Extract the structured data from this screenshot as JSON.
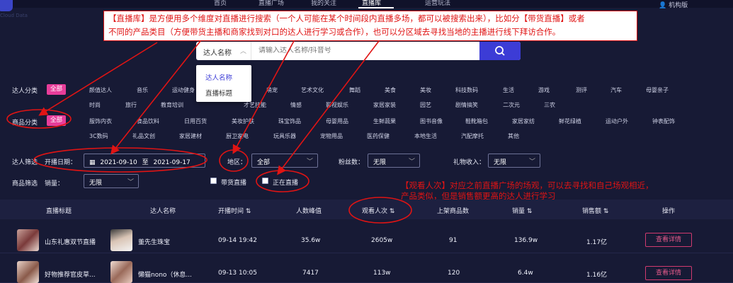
{
  "header": {
    "nav": [
      "首页",
      "直播广场",
      "我的关注",
      "直播库",
      "运营玩法"
    ],
    "active_nav": "直播库",
    "version": "机构版",
    "logo_sub": "Cloud Data"
  },
  "annotations": {
    "top_line1": "【直播库】是方便用多个维度对直播进行搜索（一个人可能在某个时间段内直播多场，都可以被搜索出来），比如分【带货直播】或者",
    "top_line2": "不同的产品类目（方便带货主播和商家找到对口的达人进行学习或合作），也可以分区域去寻找当地的主播进行线下拜访合作。",
    "mid_line1": "【观看人次】对应之前直播广场的场观，可以去寻找和自己场观相近，",
    "mid_line2": "产品类似，但是销售额更高的达人进行学习",
    "colors": {
      "red": "#e01414"
    }
  },
  "search": {
    "type_value": "达人名称",
    "placeholder": "请输入达人名称/抖音号",
    "dropdown_options": [
      "达人名称",
      "直播标题"
    ],
    "button_icon": "search-icon"
  },
  "filters": {
    "talent_category": {
      "label": "达人分类",
      "selected": "全部",
      "row1": [
        "颜值达人",
        "音乐",
        "运动健身",
        "",
        "萌宠",
        "艺术文化",
        "舞蹈",
        "美食",
        "美妆",
        "科技数码",
        "生活",
        "游戏",
        "测评",
        "汽车",
        "母婴亲子"
      ],
      "row2": [
        "时尚",
        "旅行",
        "教育培训",
        "",
        "才艺技能",
        "情感",
        "影视娱乐",
        "家居家装",
        "园艺",
        "剧情搞笑",
        "二次元",
        "三农"
      ]
    },
    "product_category": {
      "label": "商品分类",
      "selected": "全部",
      "row1": [
        "服饰内衣",
        "食品饮料",
        "日用百货",
        "美妆护肤",
        "珠宝饰品",
        "母婴用品",
        "生鲜蔬果",
        "图书音像",
        "鞋靴箱包",
        "家居家纺",
        "鲜花绿植",
        "运动户外",
        "钟表配饰"
      ],
      "row2": [
        "3C数码",
        "礼品文创",
        "家居建材",
        "厨卫家电",
        "玩具乐器",
        "宠物用品",
        "医药保健",
        "本地生活",
        "汽配摩托",
        "其他"
      ]
    },
    "talent_filter": {
      "label": "达人筛选",
      "date_label": "开播日期：",
      "date_start": "2021-09-10",
      "date_end": "2021-09-17",
      "date_sep": "至",
      "region_label": "地区：",
      "region_value": "全部",
      "fans_label": "粉丝数：",
      "fans_value": "无限",
      "gift_label": "礼物收入：",
      "gift_value": "无限"
    },
    "product_filter": {
      "label": "商品筛选",
      "sales_label": "销量：",
      "sales_value": "无限",
      "goods_live": "带货直播",
      "live_now": "正在直播"
    }
  },
  "table": {
    "headers": [
      "直播标题",
      "达人名称",
      "开播时间",
      "人数峰值",
      "观看人次",
      "上架商品数",
      "销量",
      "销售额",
      "操作"
    ],
    "rows": [
      {
        "title": "山东礼惠双节直播",
        "talent": "董先生珠宝",
        "time": "09-14 19:42",
        "peak": "35.6w",
        "views": "2605w",
        "items": "91",
        "sales": "136.9w",
        "revenue": "1.17亿",
        "action": "查看详情"
      },
      {
        "title": "好物推荐官皮草...",
        "talent": "懒猫nono（休息...",
        "time": "09-13 10:05",
        "peak": "7417",
        "views": "113w",
        "items": "120",
        "sales": "6.4w",
        "revenue": "1.16亿",
        "action": "查看详情"
      }
    ]
  },
  "colors": {
    "bg": "#171a35",
    "accent_pink": "#e83d9a",
    "primary_blue": "#3c3cd6",
    "annotation_red": "#e01414"
  }
}
